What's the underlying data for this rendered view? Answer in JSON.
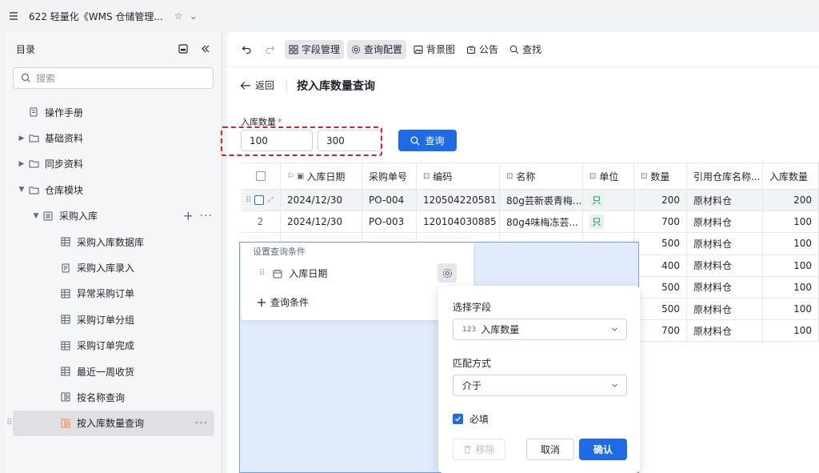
{
  "topbar": {
    "title": "622 轻量化《WMS 仓储管理...",
    "star": "☆",
    "chevron": "⌄"
  },
  "sidebar": {
    "title": "目录",
    "search_placeholder": "搜索",
    "items": [
      {
        "label": "操作手册"
      },
      {
        "label": "基础资料"
      },
      {
        "label": "同步资料"
      },
      {
        "label": "仓库模块"
      },
      {
        "label": "采购入库"
      },
      {
        "label": "采购入库数据库"
      },
      {
        "label": "采购入库录入"
      },
      {
        "label": "异常采购订单"
      },
      {
        "label": "采购订单分组"
      },
      {
        "label": "采购订单完成"
      },
      {
        "label": "最近一周收货"
      },
      {
        "label": "按名称查询"
      },
      {
        "label": "按入库数量查询"
      }
    ]
  },
  "toolbar": {
    "fields": "字段管理",
    "query_config": "查询配置",
    "background": "背景图",
    "notice": "公告",
    "find": "查找"
  },
  "page": {
    "back": "返回",
    "title": "按入库数量查询"
  },
  "filter": {
    "label": "入库数量",
    "required_mark": "*",
    "min": "100",
    "max": "300",
    "query_button": "查询"
  },
  "table": {
    "headers": [
      "入库日期",
      "采购单号",
      "编码",
      "名称",
      "单位",
      "数量",
      "引用仓库名称...",
      "入库数量"
    ],
    "rows": [
      {
        "no": "",
        "date": "2024/12/30",
        "po": "PO-004",
        "code": "120504220581",
        "name": "80g芸新裘青梅...",
        "unit": "只",
        "qty": "200",
        "wh": "原材料仓",
        "in": "200"
      },
      {
        "no": "2",
        "date": "2024/12/30",
        "po": "PO-003",
        "code": "120104030885",
        "name": "80g4味梅冻芸...",
        "unit": "只",
        "qty": "700",
        "wh": "原材料仓",
        "in": "100"
      },
      {
        "no": "",
        "date": "",
        "po": "",
        "code": "",
        "name": "",
        "unit": "",
        "qty": "500",
        "wh": "原材料仓",
        "in": "100"
      },
      {
        "no": "",
        "date": "",
        "po": "",
        "code": "",
        "name": "",
        "unit": "",
        "qty": "400",
        "wh": "原材料仓",
        "in": "100"
      },
      {
        "no": "",
        "date": "",
        "po": "",
        "code": "",
        "name": "",
        "unit": "",
        "qty": "500",
        "wh": "原材料仓",
        "in": "100"
      },
      {
        "no": "",
        "date": "",
        "po": "",
        "code": "",
        "name": "",
        "unit": "",
        "qty": "500",
        "wh": "原材料仓",
        "in": "100"
      },
      {
        "no": "",
        "date": "",
        "po": "",
        "code": "",
        "name": "",
        "unit": "",
        "qty": "700",
        "wh": "原材料仓",
        "in": "100"
      }
    ]
  },
  "query_panel": {
    "title": "设置查询条件",
    "condition": "入库日期",
    "add": "查询条件"
  },
  "field_popup": {
    "select_field_label": "选择字段",
    "field_type": "123",
    "field_value": "入库数量",
    "match_label": "匹配方式",
    "match_value": "介于",
    "required_label": "必填",
    "remove": "移除",
    "cancel": "取消",
    "confirm": "确认"
  }
}
